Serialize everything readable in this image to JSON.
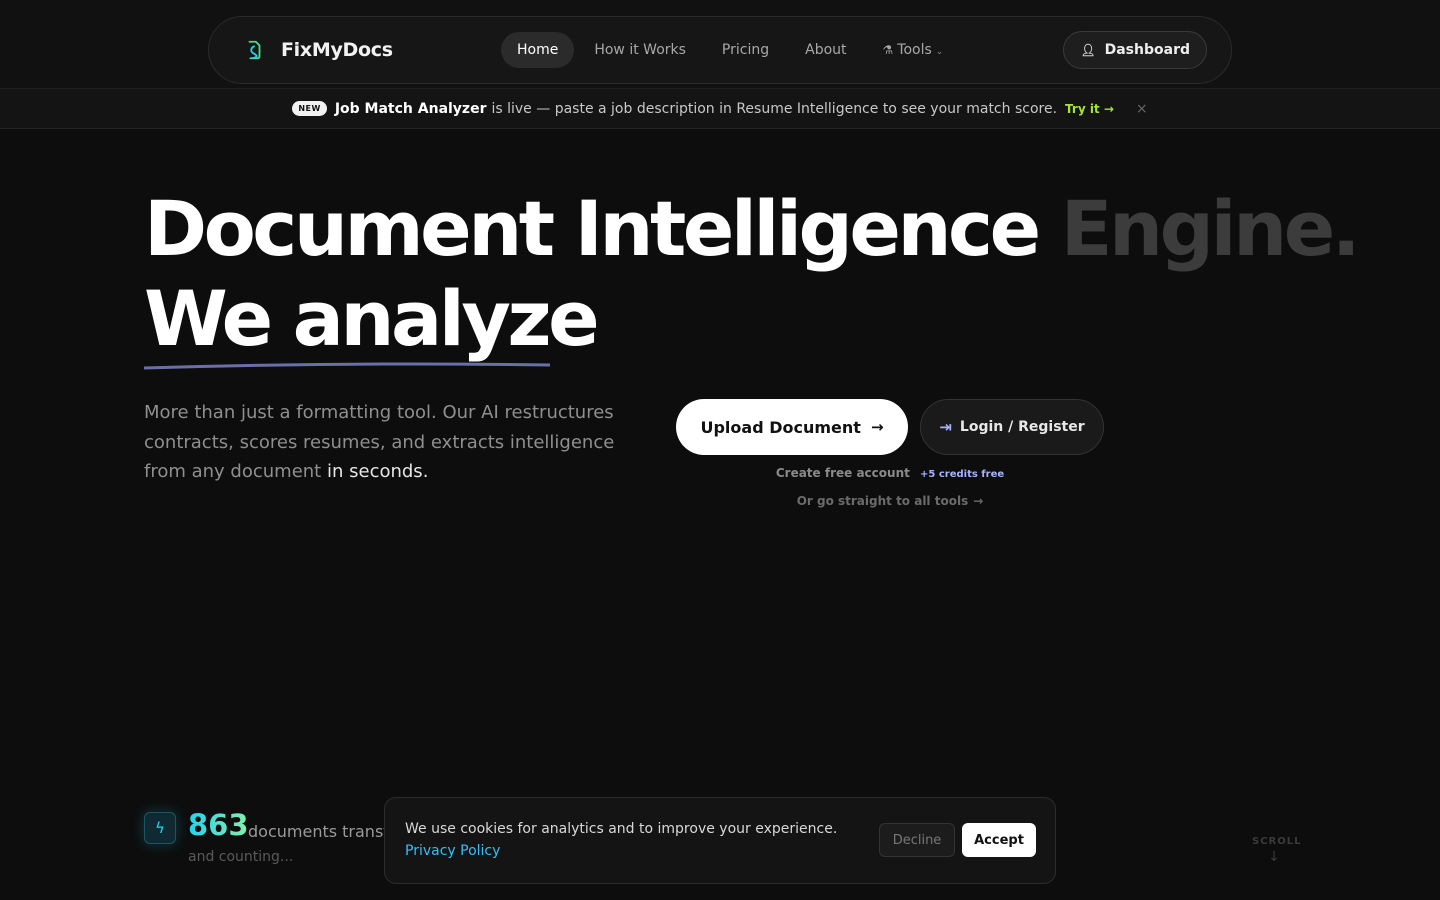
{
  "brand": {
    "name": "FixMyDocs",
    "logo_icon": "document-swirl-icon"
  },
  "nav": {
    "items": [
      {
        "label": "Home",
        "active": true
      },
      {
        "label": "How it Works"
      },
      {
        "label": "Pricing"
      },
      {
        "label": "About"
      },
      {
        "label": "Tools",
        "icon": "flask-icon",
        "dropdown": true
      }
    ],
    "dashboard_label": "Dashboard"
  },
  "announcement": {
    "badge": "NEW",
    "strong": "Job Match Analyzer",
    "text": "is live — paste a job description in Resume Intelligence to see your match score.",
    "cta": "Try it →",
    "close": "×"
  },
  "hero": {
    "line1": "Document Intelligence",
    "line1_dim": "Engine.",
    "line2": "We analyze",
    "description": "More than just a formatting tool. Our AI restructures contracts, scores resumes, and extracts intelligence from any document",
    "description_highlight": "in seconds.",
    "upload_label": "Upload Document",
    "login_label": "Login / Register",
    "free_account": "Create free account",
    "credits": "+5 credits free",
    "tools_link": "Or go straight to all tools"
  },
  "stats": {
    "count": "863",
    "label": "documents transformed",
    "sub": "and counting..."
  },
  "scroll": {
    "label": "SCROLL",
    "arrow": "↓"
  },
  "cookie": {
    "text": "We use cookies for analytics and to improve your experience.",
    "link": "Privacy Policy",
    "decline": "Decline",
    "accept": "Accept"
  },
  "colors": {
    "background": "#0d0d0d",
    "accent_green": "#a3e635",
    "accent_indigo": "#a5b4fc",
    "accent_cyan": "#22d3ee",
    "link_blue": "#38bdf8"
  }
}
